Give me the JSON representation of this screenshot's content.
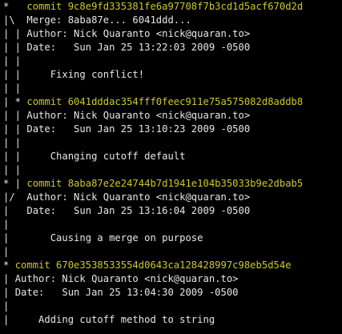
{
  "colors": {
    "background": "#000000",
    "text": "#e6e6e6",
    "commit": "#c9c92a"
  },
  "lines": [
    {
      "graph": "*   ",
      "commit": "commit 9c8e9fd335381fe6a97708f7b3cd1d5acf670d2d",
      "text": ""
    },
    {
      "graph": "|\\  ",
      "commit": "",
      "text": "Merge: 8aba87e... 6041ddd..."
    },
    {
      "graph": "| | ",
      "commit": "",
      "text": "Author: Nick Quaranto <nick@quaran.to>"
    },
    {
      "graph": "| | ",
      "commit": "",
      "text": "Date:   Sun Jan 25 13:22:03 2009 -0500"
    },
    {
      "graph": "| | ",
      "commit": "",
      "text": ""
    },
    {
      "graph": "| | ",
      "commit": "",
      "text": "    Fixing conflict!"
    },
    {
      "graph": "| | ",
      "commit": "",
      "text": ""
    },
    {
      "graph": "| * ",
      "commit": "commit 6041dddac354fff0feec911e75a575082d8addb8",
      "text": ""
    },
    {
      "graph": "| | ",
      "commit": "",
      "text": "Author: Nick Quaranto <nick@quaran.to>"
    },
    {
      "graph": "| | ",
      "commit": "",
      "text": "Date:   Sun Jan 25 13:10:23 2009 -0500"
    },
    {
      "graph": "| | ",
      "commit": "",
      "text": ""
    },
    {
      "graph": "| | ",
      "commit": "",
      "text": "    Changing cutoff default"
    },
    {
      "graph": "| | ",
      "commit": "",
      "text": ""
    },
    {
      "graph": "* | ",
      "commit": "commit 8aba87e2e24744b7d1941e104b35033b9e2dbab5",
      "text": ""
    },
    {
      "graph": "|/  ",
      "commit": "",
      "text": "Author: Nick Quaranto <nick@quaran.to>"
    },
    {
      "graph": "|   ",
      "commit": "",
      "text": "Date:   Sun Jan 25 13:16:04 2009 -0500"
    },
    {
      "graph": "|   ",
      "commit": "",
      "text": ""
    },
    {
      "graph": "|   ",
      "commit": "",
      "text": "    Causing a merge on purpose"
    },
    {
      "graph": "|   ",
      "commit": "",
      "text": ""
    },
    {
      "graph": "* ",
      "commit": "commit 670e3538533554d0643ca128428997c98eb5d54e",
      "text": ""
    },
    {
      "graph": "| ",
      "commit": "",
      "text": "Author: Nick Quaranto <nick@quaran.to>"
    },
    {
      "graph": "| ",
      "commit": "",
      "text": "Date:   Sun Jan 25 13:04:30 2009 -0500"
    },
    {
      "graph": "| ",
      "commit": "",
      "text": ""
    },
    {
      "graph": "| ",
      "commit": "",
      "text": "    Adding cutoff method to string"
    }
  ]
}
